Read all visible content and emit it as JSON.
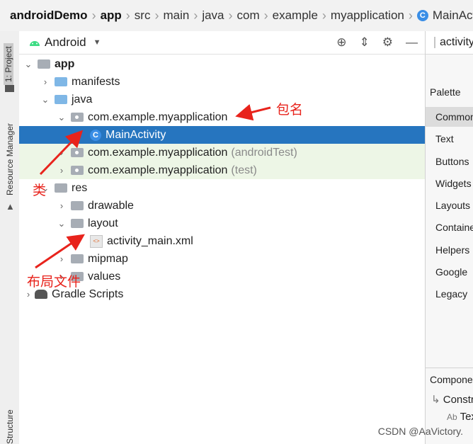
{
  "breadcrumb": [
    "androidDemo",
    "app",
    "src",
    "main",
    "java",
    "com",
    "example",
    "myapplication",
    "MainActivity"
  ],
  "breadcrumb_class_icon": "C",
  "left_strip": {
    "project": "1: Project",
    "resource_manager": "Resource Manager",
    "structure": "Structure"
  },
  "toolbar": {
    "view": "Android"
  },
  "tree": {
    "app": "app",
    "manifests": "manifests",
    "java": "java",
    "pkg_main": "com.example.myapplication",
    "main_activity": "MainActivity",
    "pkg_android_test": "com.example.myapplication",
    "android_test_suffix": "(androidTest)",
    "pkg_test": "com.example.myapplication",
    "test_suffix": "(test)",
    "res": "res",
    "drawable": "drawable",
    "layout": "layout",
    "activity_main": "activity_main.xml",
    "mipmap": "mipmap",
    "values": "values",
    "gradle": "Gradle Scripts"
  },
  "right_panel": {
    "tab": "activity_main.xml",
    "palette": "Palette",
    "categories": [
      "Common",
      "Text",
      "Buttons",
      "Widgets",
      "Layouts",
      "Containers",
      "Helpers",
      "Google",
      "Legacy"
    ],
    "component_tree": "Component Tree",
    "component_root": "ConstraintLayout",
    "component_child": "TextView",
    "component_child_icon": "Ab"
  },
  "annotations": {
    "package": "包名",
    "class": "类",
    "layout_file": "布局文件"
  },
  "watermark": "CSDN @AaVictory.",
  "colors": {
    "selection": "#2675bf",
    "test_row": "#edf6e6",
    "annotation": "#e8231c",
    "folder_blue": "#7fb7e6"
  }
}
